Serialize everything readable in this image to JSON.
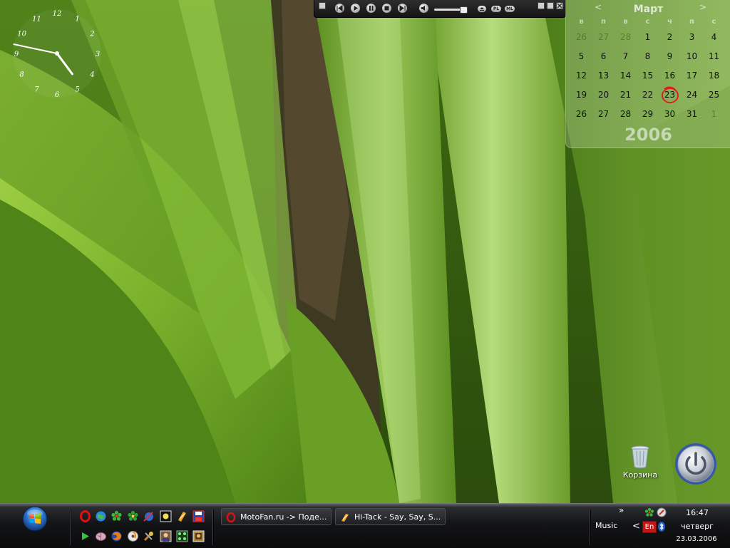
{
  "player": {
    "buttons": [
      "previous",
      "play",
      "pause",
      "stop",
      "next"
    ],
    "pills": [
      "PL",
      "ML"
    ]
  },
  "calendar": {
    "month": "Март",
    "prev_label": "<",
    "next_label": ">",
    "year": "2006",
    "weekdays": [
      "в",
      "п",
      "в",
      "с",
      "ч",
      "п",
      "с"
    ],
    "weeks": [
      [
        "26",
        "27",
        "28",
        "1",
        "2",
        "3",
        "4"
      ],
      [
        "5",
        "6",
        "7",
        "8",
        "9",
        "10",
        "11"
      ],
      [
        "12",
        "13",
        "14",
        "15",
        "16",
        "17",
        "18"
      ],
      [
        "19",
        "20",
        "21",
        "22",
        "23",
        "24",
        "25"
      ],
      [
        "26",
        "27",
        "28",
        "29",
        "30",
        "31",
        "1"
      ]
    ],
    "other_month_cells": [
      "0-0",
      "0-1",
      "0-2",
      "4-6"
    ],
    "today": "23",
    "today_color": "#e02020"
  },
  "clock": {
    "numerals": [
      "12",
      "1",
      "2",
      "3",
      "4",
      "5",
      "6",
      "7",
      "8",
      "9",
      "10",
      "11"
    ],
    "hour": 16,
    "minute": 47
  },
  "desktop": {
    "trash_label": "Корзина"
  },
  "taskbar": {
    "tasks": [
      {
        "label": "MotoFan.ru -> Поде...",
        "icon": "opera-icon"
      },
      {
        "label": "Hi-Tack - Say, Say, S...",
        "icon": "winamp-icon"
      }
    ],
    "tray": {
      "music_label": "Music",
      "chevron": "»",
      "arrow": "<",
      "language": "En",
      "time": "16:47",
      "weekday": "четверг",
      "date": "23.03.2006"
    }
  },
  "colors": {
    "accent_red": "#c21717",
    "taskbar_bg": "#131416",
    "leaf_green": "#8bc63a"
  }
}
